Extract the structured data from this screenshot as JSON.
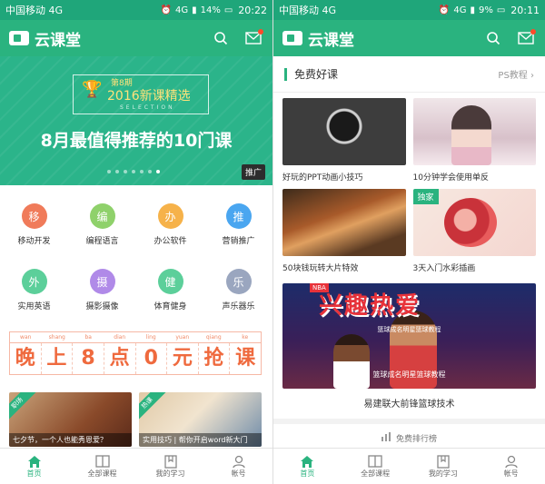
{
  "left": {
    "status": {
      "carrier": "中国移动 4G",
      "battery": "14%",
      "time": "20:22",
      "signal": "4G"
    },
    "appbar": {
      "logo": "云课堂"
    },
    "banner": {
      "issue": "第8期",
      "subtitle": "2016新课精选",
      "selection": "SELECTION",
      "title": "8月最值得推荐的10门课",
      "tag": "推广"
    },
    "categories": [
      {
        "glyph": "移",
        "label": "移动开发",
        "color": "#f07b5a"
      },
      {
        "glyph": "编",
        "label": "编程语言",
        "color": "#8fd16b"
      },
      {
        "glyph": "办",
        "label": "办公软件",
        "color": "#f6b24a"
      },
      {
        "glyph": "推",
        "label": "营销推广",
        "color": "#4aa6f0"
      },
      {
        "glyph": "外",
        "label": "实用英语",
        "color": "#5ccf9a"
      },
      {
        "glyph": "摄",
        "label": "摄影摄像",
        "color": "#b08ae8"
      },
      {
        "glyph": "健",
        "label": "体育健身",
        "color": "#5ccf9a"
      },
      {
        "glyph": "乐",
        "label": "声乐器乐",
        "color": "#9aa6bf"
      }
    ],
    "evening": {
      "pinyin": [
        "wan",
        "shang",
        "ba",
        "dian",
        "ling",
        "yuan",
        "qiang",
        "ke"
      ],
      "hanzi": [
        "晚",
        "上",
        "8",
        "点",
        "0",
        "元",
        "抢",
        "课"
      ]
    },
    "cards": [
      {
        "ribbon": "职场",
        "caption": "七夕节，一个人也能秀恩爱？"
      },
      {
        "ribbon": "热课",
        "caption": "实用技巧 | 帮你开启word新大门"
      }
    ]
  },
  "right": {
    "status": {
      "carrier": "中国移动 4G",
      "battery": "9%",
      "time": "20:11",
      "signal": "4G"
    },
    "appbar": {
      "logo": "云课堂"
    },
    "section": {
      "title": "免费好课",
      "more": "PS教程"
    },
    "grid": [
      {
        "caption": "好玩的PPT动画小技巧",
        "badge": ""
      },
      {
        "caption": "10分钟学会使用单反",
        "badge": ""
      },
      {
        "caption": "50块钱玩转大片特效",
        "badge": ""
      },
      {
        "caption": "3天入门水彩插画",
        "badge": "独家"
      }
    ],
    "big": {
      "tag": "NBA",
      "hero": "兴趣热爱",
      "slogan": "篮球成名明星篮球教程",
      "subt": "篮球成名明星篮球教程",
      "caption": "易建联大前锋篮球技术"
    },
    "rank": "免费排行榜"
  },
  "bottomnav": [
    {
      "label": "首页",
      "icon": "home-icon"
    },
    {
      "label": "全部课程",
      "icon": "book-icon"
    },
    {
      "label": "我的学习",
      "icon": "study-icon"
    },
    {
      "label": "帐号",
      "icon": "user-icon"
    }
  ],
  "colors": {
    "brand": "#2ab37f",
    "statusbar": "#1fa67a",
    "accent": "#ef6a3e"
  }
}
